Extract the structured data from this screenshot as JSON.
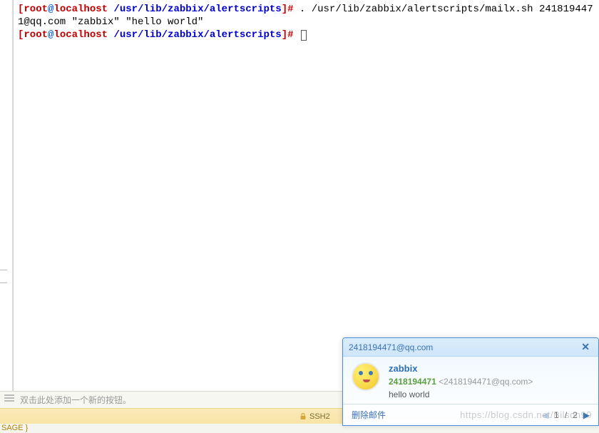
{
  "terminal": {
    "prompt": {
      "open": "[",
      "close": "]",
      "user": "root",
      "at": "@",
      "host": "localhost",
      "path": "/usr/lib/zabbix/alertscripts",
      "hash": "#"
    },
    "command1": ". /usr/lib/zabbix/alertscripts/mailx.sh 2418194471@qq.com \"zabbix\" \"hello world\""
  },
  "toolbar": {
    "hint": "双击此处添加一个新的按钮。"
  },
  "statusbar": {
    "protocol": "SSH2"
  },
  "bottomtab": {
    "label": "SAGE }"
  },
  "notif": {
    "header": "2418194471@qq.com",
    "subject": "zabbix",
    "sender_id": "2418194471",
    "sender_addr": "<2418194471@qq.com>",
    "message": "hello world",
    "delete_label": "删除邮件",
    "page_current": "1",
    "page_sep": "/",
    "page_total": "2"
  },
  "watermark": {
    "text": "https://blog.csdn.net/Bilson99"
  }
}
